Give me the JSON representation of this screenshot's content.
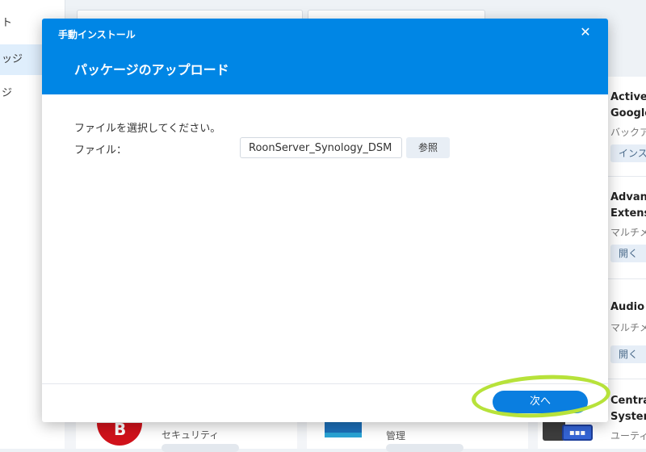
{
  "left_nav": {
    "items": [
      {
        "label": "ト"
      },
      {
        "label": "ッジ"
      },
      {
        "label": "ジ"
      }
    ]
  },
  "packages": [
    {
      "title_line1": "Active",
      "title_line2": "Google",
      "category": "バックア",
      "button": "インス"
    },
    {
      "title_line1": "Advan",
      "title_line2": "Extens",
      "category": "マルチメ",
      "button": "開く"
    },
    {
      "title_line1": "Audio",
      "title_line2": "",
      "category": "マルチメ",
      "button": "開く"
    },
    {
      "title_line1": "Centra",
      "title_line2": "System",
      "category": "ユーティ",
      "button": ""
    }
  ],
  "bottom_row": {
    "item1_category": "セキュリティ",
    "item2_category": "管理"
  },
  "dialog": {
    "window_title": "手動インストール",
    "close_icon": "close-icon",
    "heading": "パッケージのアップロード",
    "instruction": "ファイルを選択してください。",
    "file_label": "ファイル：",
    "file_value": "RoonServer_Synology_DSM",
    "browse_label": "参照",
    "next_label": "次へ",
    "colors": {
      "header": "#0086e5",
      "primary_button": "#0a7ee0",
      "annotation_ring": "#b7e23a"
    }
  }
}
